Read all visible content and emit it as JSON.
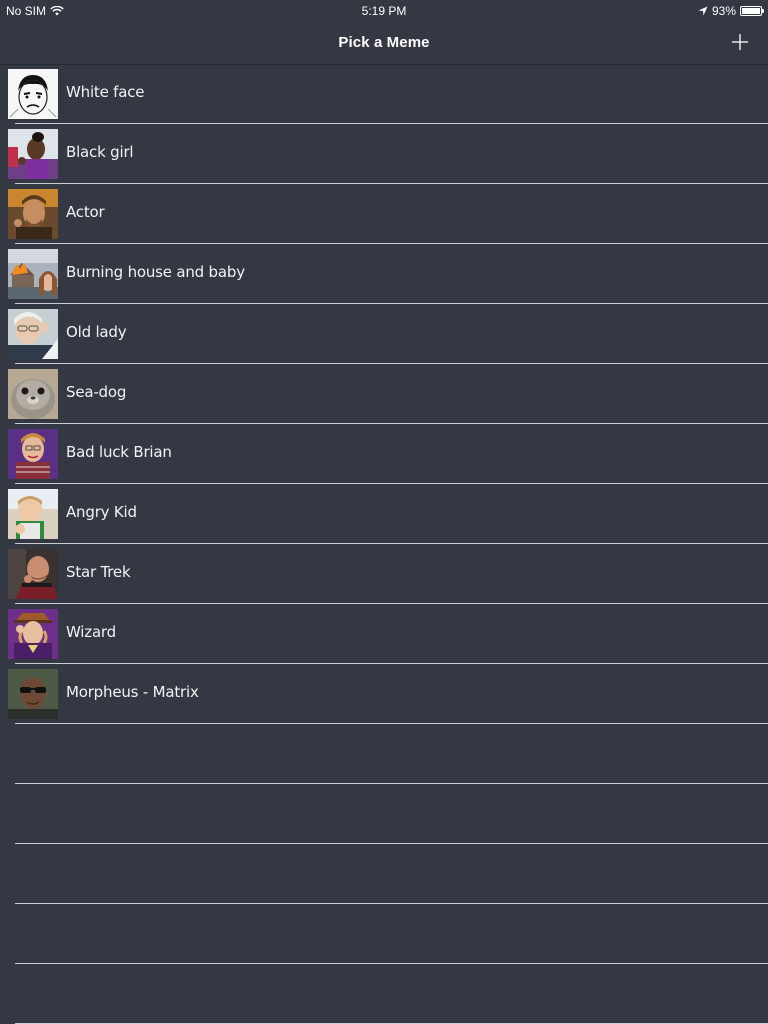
{
  "status_bar": {
    "carrier": "No SIM",
    "time": "5:19 PM",
    "battery": "93%",
    "icons": [
      "wifi-icon",
      "location-arrow-icon",
      "battery-icon"
    ]
  },
  "nav": {
    "title": "Pick a Meme",
    "add_icon": "plus-icon"
  },
  "memes": [
    {
      "label": "White face",
      "thumb": "white-face-thumbnail"
    },
    {
      "label": "Black girl",
      "thumb": "black-girl-thumbnail"
    },
    {
      "label": "Actor",
      "thumb": "actor-thumbnail"
    },
    {
      "label": "Burning house and baby",
      "thumb": "burning-house-thumbnail"
    },
    {
      "label": "Old lady",
      "thumb": "old-lady-thumbnail"
    },
    {
      "label": "Sea-dog",
      "thumb": "sea-dog-thumbnail"
    },
    {
      "label": "Bad luck Brian",
      "thumb": "bad-luck-brian-thumbnail"
    },
    {
      "label": "Angry Kid",
      "thumb": "angry-kid-thumbnail"
    },
    {
      "label": "Star Trek",
      "thumb": "star-trek-thumbnail"
    },
    {
      "label": "Wizard",
      "thumb": "wizard-thumbnail"
    },
    {
      "label": "Morpheus - Matrix",
      "thumb": "morpheus-thumbnail"
    }
  ],
  "colors": {
    "background": "#333842",
    "separator": "#c9ccd1",
    "text": "#ffffff"
  }
}
